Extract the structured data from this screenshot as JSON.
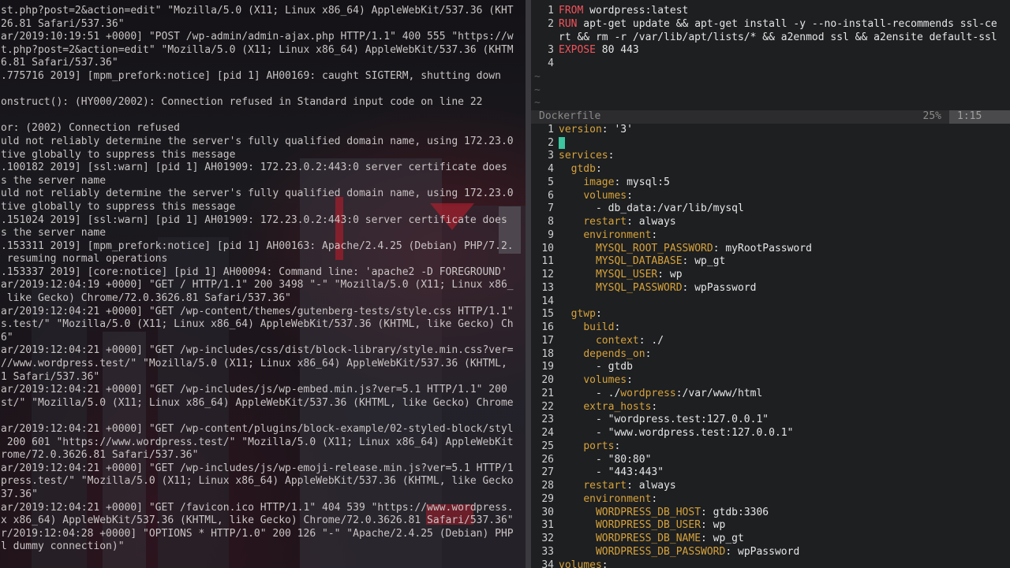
{
  "log_terminal": {
    "lines": [
      "st.php?post=2&action=edit\" \"Mozilla/5.0 (X11; Linux x86_64) AppleWebKit/537.36 (KHT",
      "26.81 Safari/537.36\"",
      "ar/2019:10:19:51 +0000] \"POST /wp-admin/admin-ajax.php HTTP/1.1\" 400 555 \"https://w",
      "t.php?post=2&action=edit\" \"Mozilla/5.0 (X11; Linux x86_64) AppleWebKit/537.36 (KHTM",
      "6.81 Safari/537.36\"",
      ".775716 2019] [mpm_prefork:notice] [pid 1] AH00169: caught SIGTERM, shutting down",
      "",
      "onstruct(): (HY000/2002): Connection refused in Standard input code on line 22",
      "",
      "or: (2002) Connection refused",
      "uld not reliably determine the server's fully qualified domain name, using 172.23.0",
      "tive globally to suppress this message",
      ".100182 2019] [ssl:warn] [pid 1] AH01909: 172.23.0.2:443:0 server certificate does",
      "s the server name",
      "uld not reliably determine the server's fully qualified domain name, using 172.23.0",
      "tive globally to suppress this message",
      ".151024 2019] [ssl:warn] [pid 1] AH01909: 172.23.0.2:443:0 server certificate does",
      "s the server name",
      ".153311 2019] [mpm_prefork:notice] [pid 1] AH00163: Apache/2.4.25 (Debian) PHP/7.2.",
      " resuming normal operations",
      ".153337 2019] [core:notice] [pid 1] AH00094: Command line: 'apache2 -D FOREGROUND'",
      "ar/2019:12:04:19 +0000] \"GET / HTTP/1.1\" 200 3498 \"-\" \"Mozilla/5.0 (X11; Linux x86_",
      " like Gecko) Chrome/72.0.3626.81 Safari/537.36\"",
      "ar/2019:12:04:21 +0000] \"GET /wp-content/themes/gutenberg-tests/style.css HTTP/1.1\"",
      "s.test/\" \"Mozilla/5.0 (X11; Linux x86_64) AppleWebKit/537.36 (KHTML, like Gecko) Ch",
      "6\"",
      "ar/2019:12:04:21 +0000] \"GET /wp-includes/css/dist/block-library/style.min.css?ver=",
      "//www.wordpress.test/\" \"Mozilla/5.0 (X11; Linux x86_64) AppleWebKit/537.36 (KHTML,",
      "1 Safari/537.36\"",
      "ar/2019:12:04:21 +0000] \"GET /wp-includes/js/wp-embed.min.js?ver=5.1 HTTP/1.1\" 200",
      "st/\" \"Mozilla/5.0 (X11; Linux x86_64) AppleWebKit/537.36 (KHTML, like Gecko) Chrome",
      "",
      "ar/2019:12:04:21 +0000] \"GET /wp-content/plugins/block-example/02-styled-block/styl",
      " 200 601 \"https://www.wordpress.test/\" \"Mozilla/5.0 (X11; Linux x86_64) AppleWebKit",
      "rome/72.0.3626.81 Safari/537.36\"",
      "ar/2019:12:04:21 +0000] \"GET /wp-includes/js/wp-emoji-release.min.js?ver=5.1 HTTP/1",
      "press.test/\" \"Mozilla/5.0 (X11; Linux x86_64) AppleWebKit/537.36 (KHTML, like Gecko",
      "37.36\"",
      "ar/2019:12:04:21 +0000] \"GET /favicon.ico HTTP/1.1\" 404 539 \"https://www.wordpress.",
      "x x86_64) AppleWebKit/537.36 (KHTML, like Gecko) Chrome/72.0.3626.81 Safari/537.36\"",
      "r/2019:12:04:28 +0000] \"OPTIONS * HTTP/1.0\" 200 126 \"-\" \"Apache/2.4.25 (Debian) PHP",
      "l dummy connection)\""
    ]
  },
  "dockerfile": {
    "lines": [
      {
        "n": "1",
        "kw": "FROM",
        "rest": " wordpress:latest"
      },
      {
        "n": "2",
        "kw": "RUN",
        "rest": " apt-get update && apt-get install -y --no-install-recommends ssl-ce"
      },
      {
        "n": "",
        "kw": "",
        "rest": "rt && rm -r /var/lib/apt/lists/* && a2enmod ssl && a2ensite default-ssl"
      },
      {
        "n": "3",
        "kw": "EXPOSE",
        "rest": " 80 443"
      },
      {
        "n": "4",
        "kw": "",
        "rest": ""
      }
    ],
    "tildes": [
      "~",
      "~",
      "~"
    ],
    "status": {
      "filename": "Dockerfile",
      "percent": "25%",
      "position": "1:15"
    }
  },
  "compose": {
    "lines": [
      {
        "n": "1",
        "key": "version",
        "val": " '3'"
      },
      {
        "n": "2",
        "key": "",
        "val": ""
      },
      {
        "n": "3",
        "key": "services",
        "val": ""
      },
      {
        "n": "4",
        "key": "  gtdb",
        "val": ""
      },
      {
        "n": "5",
        "key": "    image",
        "val": " mysql:5"
      },
      {
        "n": "6",
        "key": "    volumes",
        "val": ""
      },
      {
        "n": "7",
        "key": "",
        "val": "      - db_data:/var/lib/mysql"
      },
      {
        "n": "8",
        "key": "    restart",
        "val": " always"
      },
      {
        "n": "9",
        "key": "    environment",
        "val": ""
      },
      {
        "n": "10",
        "key": "      MYSQL_ROOT_PASSWORD",
        "val": " myRootPassword"
      },
      {
        "n": "11",
        "key": "      MYSQL_DATABASE",
        "val": " wp_gt"
      },
      {
        "n": "12",
        "key": "      MYSQL_USER",
        "val": " wp"
      },
      {
        "n": "13",
        "key": "      MYSQL_PASSWORD",
        "val": " wpPassword"
      },
      {
        "n": "14",
        "key": "",
        "val": ""
      },
      {
        "n": "15",
        "key": "  gtwp",
        "val": ""
      },
      {
        "n": "16",
        "key": "    build",
        "val": ""
      },
      {
        "n": "17",
        "key": "      context",
        "val": " ./"
      },
      {
        "n": "18",
        "key": "    depends_on",
        "val": ""
      },
      {
        "n": "19",
        "key": "",
        "val": "      - gtdb"
      },
      {
        "n": "20",
        "key": "    volumes",
        "val": ""
      },
      {
        "n": "21",
        "key": "",
        "val": "      - ./wordpress:/var/www/html"
      },
      {
        "n": "22",
        "key": "    extra_hosts",
        "val": ""
      },
      {
        "n": "23",
        "key": "",
        "val": "      - \"wordpress.test:127.0.0.1\""
      },
      {
        "n": "24",
        "key": "",
        "val": "      - \"www.wordpress.test:127.0.0.1\""
      },
      {
        "n": "25",
        "key": "    ports",
        "val": ""
      },
      {
        "n": "26",
        "key": "",
        "val": "      - \"80:80\""
      },
      {
        "n": "27",
        "key": "",
        "val": "      - \"443:443\""
      },
      {
        "n": "28",
        "key": "    restart",
        "val": " always"
      },
      {
        "n": "29",
        "key": "    environment",
        "val": ""
      },
      {
        "n": "30",
        "key": "      WORDPRESS_DB_HOST",
        "val": " gtdb:3306"
      },
      {
        "n": "31",
        "key": "      WORDPRESS_DB_USER",
        "val": " wp"
      },
      {
        "n": "32",
        "key": "      WORDPRESS_DB_NAME",
        "val": " wp_gt"
      },
      {
        "n": "33",
        "key": "      WORDPRESS_DB_PASSWORD",
        "val": " wpPassword"
      },
      {
        "n": "34",
        "key": "volumes",
        "val": ""
      }
    ]
  },
  "colors": {
    "background": "#1d1f21",
    "keyword_red": "#f2545b",
    "key_orange": "#d7a23a",
    "cursor_teal": "#3cc59f",
    "log_text": "#c9c4c4"
  }
}
